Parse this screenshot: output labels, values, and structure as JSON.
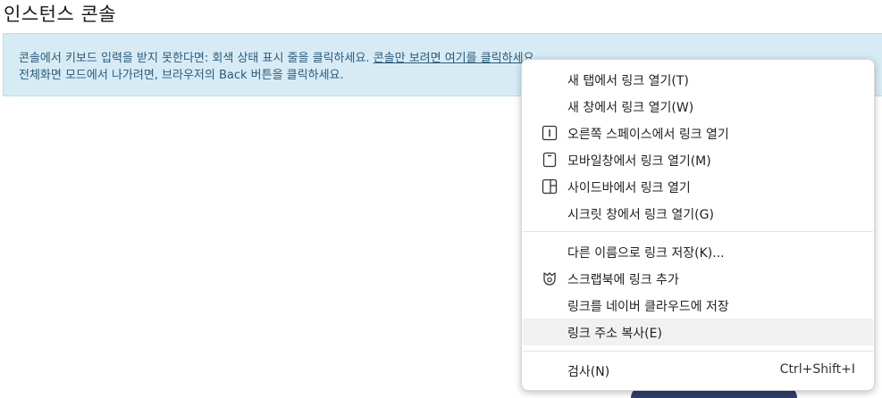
{
  "page": {
    "title": "인스턴스 콘솔"
  },
  "alert": {
    "line1_text": "콘솔에서 키보드 입력을 받지 못한다면: 회색 상태 표시 줄을 클릭하세요.",
    "line1_link": "콘솔만 보려면 여기를 클릭하세요.",
    "line2_text": "전체화면 모드에서 나가려면, 브라우저의 Back 버튼을 클릭하세요."
  },
  "context_menu": {
    "items": [
      {
        "label": "새 탭에서 링크 열기(T)",
        "icon": ""
      },
      {
        "label": "새 창에서 링크 열기(W)",
        "icon": ""
      },
      {
        "label": "오른쪽 스페이스에서 링크 열기",
        "icon": "split-space-icon"
      },
      {
        "label": "모바일창에서 링크 열기(M)",
        "icon": "mobile-window-icon"
      },
      {
        "label": "사이드바에서 링크 열기",
        "icon": "sidebar-icon"
      },
      {
        "label": "시크릿 창에서 링크 열기(G)",
        "icon": ""
      },
      {
        "label": "다른 이름으로 링크 저장(K)...",
        "icon": ""
      },
      {
        "label": "스크랩북에 링크 추가",
        "icon": "scrapbook-icon"
      },
      {
        "label": "링크를 네이버 클라우드에 저장",
        "icon": ""
      },
      {
        "label": "링크 주소 복사(E)",
        "icon": "",
        "highlighted": true
      },
      {
        "label": "검사(N)",
        "icon": "",
        "shortcut": "Ctrl+Shift+I"
      }
    ]
  }
}
